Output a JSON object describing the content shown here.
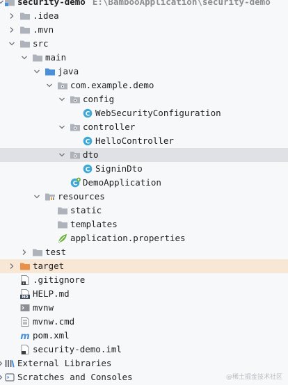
{
  "project_tree": {
    "rows": [
      {
        "label": "security-demo",
        "path": "E:\\BambooApplication\\security-demo",
        "icon": "module-folder-icon",
        "depth": 0,
        "arrow": "expanded",
        "bold": true
      },
      {
        "label": ".idea",
        "icon": "folder-icon",
        "depth": 1,
        "arrow": "collapsed"
      },
      {
        "label": ".mvn",
        "icon": "folder-icon",
        "depth": 1,
        "arrow": "collapsed"
      },
      {
        "label": "src",
        "icon": "folder-icon",
        "depth": 1,
        "arrow": "expanded"
      },
      {
        "label": "main",
        "icon": "folder-icon",
        "depth": 2,
        "arrow": "expanded"
      },
      {
        "label": "java",
        "icon": "source-folder-icon",
        "depth": 3,
        "arrow": "expanded"
      },
      {
        "label": "com.example.demo",
        "icon": "package-icon",
        "depth": 4,
        "arrow": "expanded"
      },
      {
        "label": "config",
        "icon": "package-icon",
        "depth": 5,
        "arrow": "expanded"
      },
      {
        "label": "WebSecurityConfiguration",
        "icon": "java-class-icon",
        "depth": 6,
        "arrow": "none"
      },
      {
        "label": "controller",
        "icon": "package-icon",
        "depth": 5,
        "arrow": "expanded"
      },
      {
        "label": "HelloController",
        "icon": "java-class-icon",
        "depth": 6,
        "arrow": "none"
      },
      {
        "label": "dto",
        "icon": "package-icon",
        "depth": 5,
        "arrow": "expanded",
        "selected": true
      },
      {
        "label": "SigninDto",
        "icon": "java-class-icon",
        "depth": 6,
        "arrow": "none"
      },
      {
        "label": "DemoApplication",
        "icon": "spring-boot-class-icon",
        "depth": 5,
        "arrow": "none"
      },
      {
        "label": "resources",
        "icon": "resources-folder-icon",
        "depth": 3,
        "arrow": "expanded"
      },
      {
        "label": "static",
        "icon": "folder-icon",
        "depth": 4,
        "arrow": "none"
      },
      {
        "label": "templates",
        "icon": "folder-icon",
        "depth": 4,
        "arrow": "none"
      },
      {
        "label": "application.properties",
        "icon": "properties-file-icon",
        "depth": 4,
        "arrow": "none"
      },
      {
        "label": "test",
        "icon": "folder-icon",
        "depth": 2,
        "arrow": "collapsed"
      },
      {
        "label": "target",
        "icon": "excluded-folder-icon",
        "depth": 1,
        "arrow": "collapsed",
        "excluded": true
      },
      {
        "label": ".gitignore",
        "icon": "gitignore-file-icon",
        "depth": 1,
        "arrow": "none"
      },
      {
        "label": "HELP.md",
        "icon": "markdown-file-icon",
        "depth": 1,
        "arrow": "none"
      },
      {
        "label": "mvnw",
        "icon": "shell-file-icon",
        "depth": 1,
        "arrow": "none"
      },
      {
        "label": "mvnw.cmd",
        "icon": "text-file-icon",
        "depth": 1,
        "arrow": "none"
      },
      {
        "label": "pom.xml",
        "icon": "maven-file-icon",
        "depth": 1,
        "arrow": "none"
      },
      {
        "label": "security-demo.iml",
        "icon": "iml-file-icon",
        "depth": 1,
        "arrow": "none"
      },
      {
        "label": "External Libraries",
        "icon": "libraries-icon",
        "depth": 0,
        "arrow": "collapsed"
      },
      {
        "label": "Scratches and Consoles",
        "icon": "scratches-icon",
        "depth": 0,
        "arrow": "collapsed"
      }
    ]
  },
  "watermark": "@稀土掘金技术社区",
  "colors": {
    "background": "#f7f8fa",
    "selected_row": "#dfe1e5",
    "excluded_row": "#f9e7d6",
    "folder": "#aeb3bb",
    "source_folder": "#4a90d9",
    "class_icon": "#40a8d4",
    "excluded_folder": "#e8914a"
  }
}
